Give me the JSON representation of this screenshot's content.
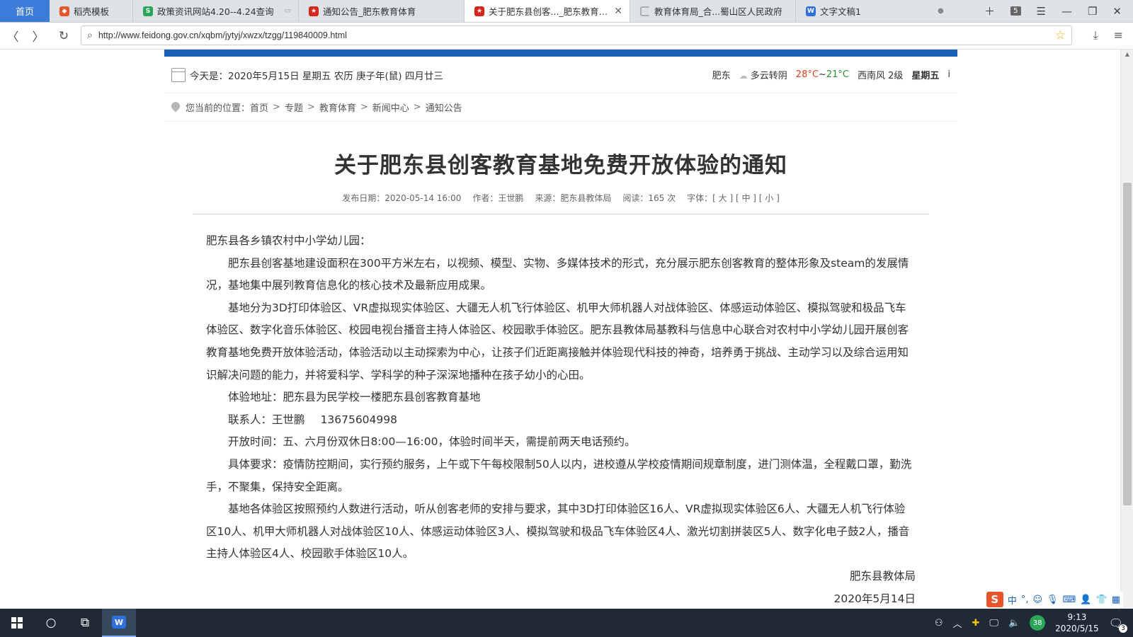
{
  "browser": {
    "home_tab": "首页",
    "tabs": [
      {
        "label": "稻壳模板",
        "icon": "docer-icon",
        "active": false,
        "narrow": true
      },
      {
        "label": "政策资讯网站4.20--4.24查询",
        "icon": "s-sheet-icon",
        "active": false,
        "narrow": false,
        "extra": "▭"
      },
      {
        "label": "通知公告_肥东教育体育",
        "icon": "emblem-icon",
        "active": false,
        "narrow": false
      },
      {
        "label": "关于肥东县创客..._肥东教育体育",
        "icon": "emblem-icon",
        "active": true,
        "narrow": false
      },
      {
        "label": "教育体育局_合...蜀山区人民政府",
        "icon": "loading-icon",
        "active": false,
        "narrow": false
      },
      {
        "label": "文字文稿1",
        "icon": "wps-icon",
        "active": false,
        "narrow": false
      }
    ],
    "tab_count": "5",
    "url": "http://www.feidong.gov.cn/xqbm/jytyj/xwzx/tzgg/119840009.html"
  },
  "header": {
    "date_line": "今天是：2020年5月15日 星期五 农历 庚子年(鼠) 四月廿三",
    "weather": {
      "city": "肥东",
      "condition": "多云转阴",
      "high": "28°C",
      "sep": "~",
      "low": "21°C",
      "wind": "西南风 2级",
      "weekday": "星期五",
      "cut": "i"
    }
  },
  "breadcrumb": {
    "prefix": "您当前的位置：",
    "items": [
      "首页",
      "专题",
      "教育体育",
      "新闻中心",
      "通知公告"
    ],
    "sep": ">"
  },
  "article": {
    "title": "关于肥东县创客教育基地免费开放体验的通知",
    "meta": {
      "date": "发布日期：2020-05-14 16:00",
      "author": "作者：王世鹏",
      "source": "来源：肥东县教体局",
      "views": "阅读：165 次",
      "font": "字体：[ 大 ] [ 中 ] [ 小 ]"
    },
    "salutation": "肥东县各乡镇农村中小学幼儿园：",
    "paragraphs": [
      "肥东县创客基地建设面积在300平方米左右，以视频、模型、实物、多媒体技术的形式，充分展示肥东创客教育的整体形象及steam的发展情况，基地集中展列教育信息化的核心技术及最新应用成果。",
      "基地分为3D打印体验区、VR虚拟现实体验区、大疆无人机飞行体验区、机甲大师机器人对战体验区、体感运动体验区、模拟驾驶和极品飞车体验区、数字化音乐体验区、校园电视台播音主持人体验区、校园歌手体验区。肥东县教体局基教科与信息中心联合对农村中小学幼儿园开展创客教育基地免费开放体验活动，体验活动以主动探索为中心，让孩子们近距离接触并体验现代科技的神奇，培养勇于挑战、主动学习以及综合运用知识解决问题的能力，并将爱科学、学科学的种子深深地播种在孩子幼小的心田。",
      "体验地址：肥东县为民学校一楼肥东县创客教育基地"
    ],
    "contact_label": "联系人：王世鹏",
    "contact_phone": "13675604998",
    "paragraphs2": [
      "开放时间：五、六月份双休日8:00—16:00，体验时间半天，需提前两天电话预约。",
      "具体要求：疫情防控期间，实行预约服务，上午或下午每校限制50人以内，进校遵从学校疫情期间规章制度，进门测体温，全程戴口罩，勤洗手，不聚集，保持安全距离。",
      "基地各体验区按照预约人数进行活动，听从创客老师的安排与要求，其中3D打印体验区16人、VR虚拟现实体验区6人、大疆无人机飞行体验区10人、机甲大师机器人对战体验区10人、体感运动体验区3人、模拟驾驶和极品飞车体验区4人、激光切割拼装区5人、数字化电子鼓2人，播音主持人体验区4人、校园歌手体验区10人。"
    ],
    "signature": "肥东县教体局",
    "sign_date": "2020年5月14日"
  },
  "ime": {
    "lang": "中",
    "punct": "°,"
  },
  "taskbar": {
    "badge": "38",
    "time": "9:13",
    "date": "2020/5/15",
    "notif_count": "3"
  }
}
